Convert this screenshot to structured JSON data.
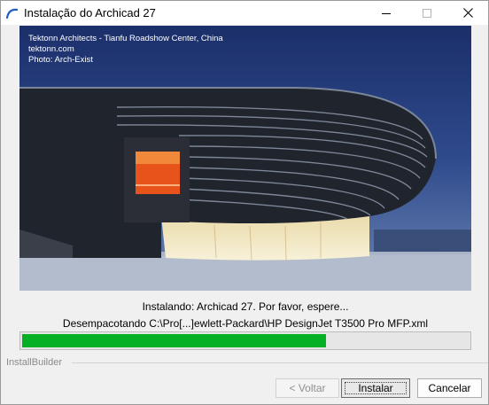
{
  "window": {
    "title": "Instalação do Archicad 27"
  },
  "photo": {
    "credit_line1": "Tektonn Architects - Tianfu Roadshow Center, China",
    "credit_line2": "tektonn.com",
    "credit_line3": "Photo: Arch-Exist"
  },
  "status": {
    "installing": "Instalando: Archicad 27. Por favor, espere...",
    "unpacking": "Desempacotando C:\\Pro[...]ewlett-Packard\\HP DesignJet T3500 Pro MFP.xml"
  },
  "progress": {
    "fraction": 0.68,
    "color": "#06b025"
  },
  "footer": {
    "brand": "InstallBuilder",
    "back_label": "< Voltar",
    "install_label": "Instalar",
    "cancel_label": "Cancelar"
  },
  "icons": {
    "app": "archicad-logo-icon",
    "minimize": "minimize-icon",
    "maximize": "maximize-icon",
    "close": "close-icon"
  }
}
